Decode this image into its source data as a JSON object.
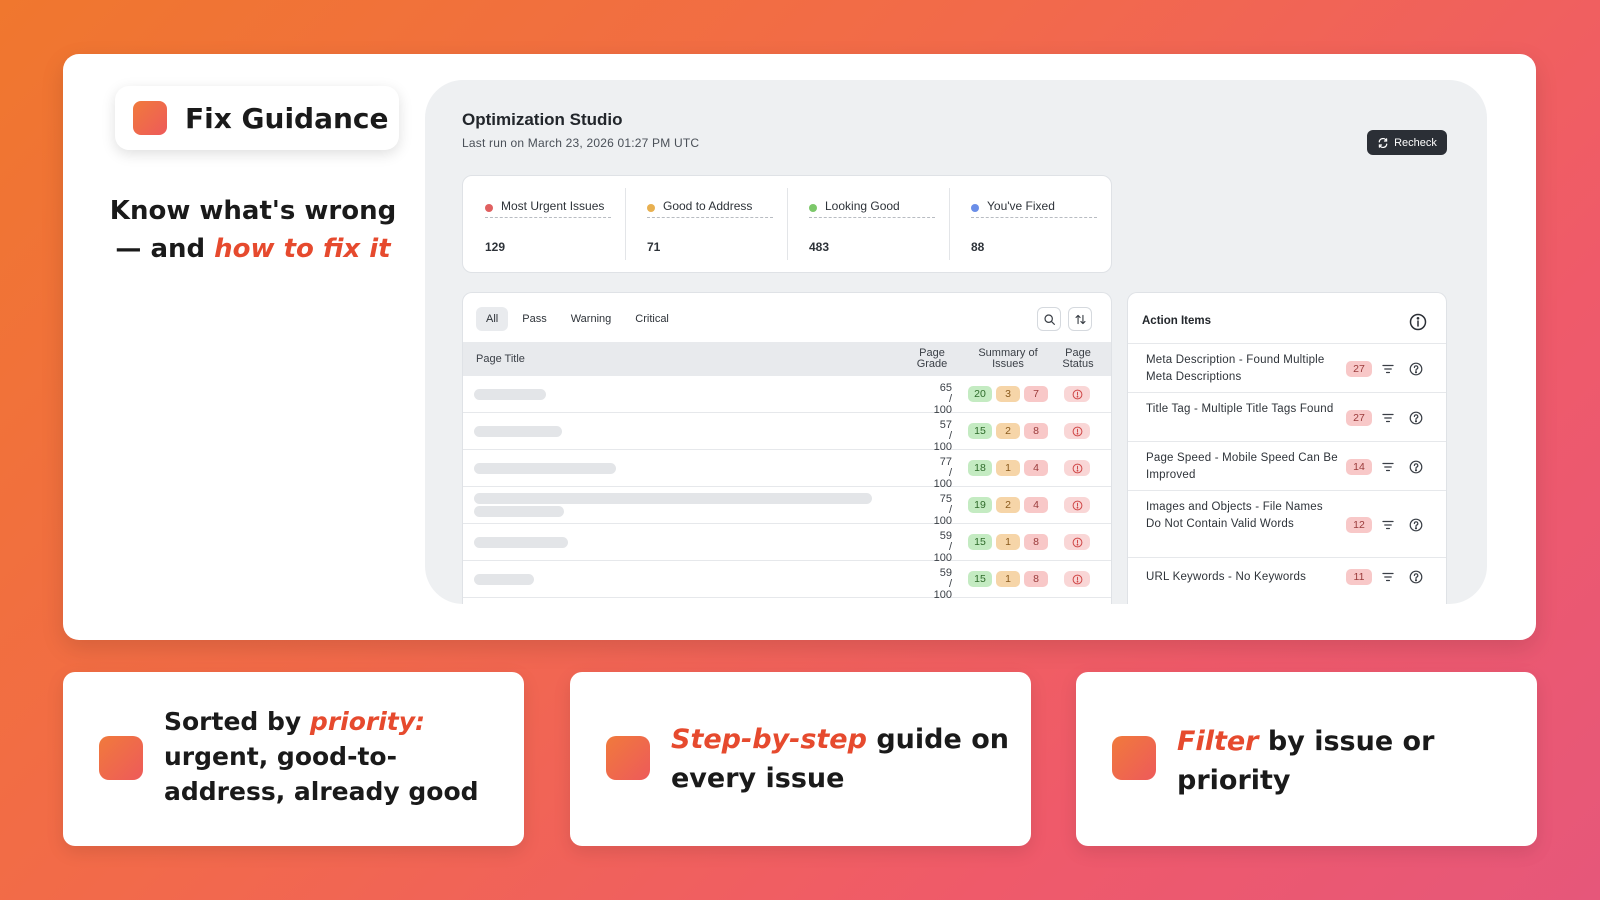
{
  "hero": {
    "title": "Fix Guidance",
    "tagline_line1": "Know what's wrong",
    "tagline_line2_prefix": "— and ",
    "tagline_line2_highlight": "how to fix it"
  },
  "studio": {
    "title": "Optimization Studio",
    "last_run": "Last run on March 23, 2026 01:27 PM UTC",
    "recheck_label": "Recheck",
    "stats": [
      {
        "label": "Most Urgent Issues",
        "value": "129",
        "color": "#e06060"
      },
      {
        "label": "Good to Address",
        "value": "71",
        "color": "#e8b050"
      },
      {
        "label": "Looking Good",
        "value": "483",
        "color": "#7cc86a"
      },
      {
        "label": "You've Fixed",
        "value": "88",
        "color": "#6a8ee8"
      }
    ],
    "tabs": [
      "All",
      "Pass",
      "Warning",
      "Critical"
    ],
    "active_tab": "All",
    "columns": {
      "page_title": "Page Title",
      "page_grade": "Page Grade",
      "summary": "Summary of Issues",
      "status": "Page Status"
    },
    "rows": [
      {
        "grade": "65 / 100",
        "pass": "20",
        "warn": "3",
        "crit": "7"
      },
      {
        "grade": "57 / 100",
        "pass": "15",
        "warn": "2",
        "crit": "8"
      },
      {
        "grade": "77 / 100",
        "pass": "18",
        "warn": "1",
        "crit": "4"
      },
      {
        "grade": "75 / 100",
        "pass": "19",
        "warn": "2",
        "crit": "4"
      },
      {
        "grade": "59 / 100",
        "pass": "15",
        "warn": "1",
        "crit": "8"
      },
      {
        "grade": "59 / 100",
        "pass": "15",
        "warn": "1",
        "crit": "8"
      }
    ],
    "action_items": {
      "title": "Action Items",
      "items": [
        {
          "text": "Meta Description - Found Multiple Meta Descriptions",
          "count": "27"
        },
        {
          "text": "Title Tag - Multiple Title Tags Found",
          "count": "27"
        },
        {
          "text": "Page Speed - Mobile Speed Can Be Improved",
          "count": "14"
        },
        {
          "text": "Images and Objects - File Names Do Not Contain Valid Words",
          "count": "12"
        },
        {
          "text": "URL Keywords - No Keywords",
          "count": "11"
        }
      ]
    }
  },
  "features": [
    {
      "prefix": "Sorted by ",
      "highlight": "priority:",
      "suffix": "urgent, good-to-address, already good"
    },
    {
      "prefix": "",
      "highlight": "Step-by-step",
      "suffix": " guide on every issue"
    },
    {
      "prefix": "",
      "highlight": "Filter",
      "suffix": " by issue or priority"
    }
  ],
  "colors": {
    "accent": "#e64a2e",
    "pass_chip": "#c4ebc2",
    "warn_chip": "#f6d5a8",
    "crit_chip": "#f8c8c8"
  }
}
